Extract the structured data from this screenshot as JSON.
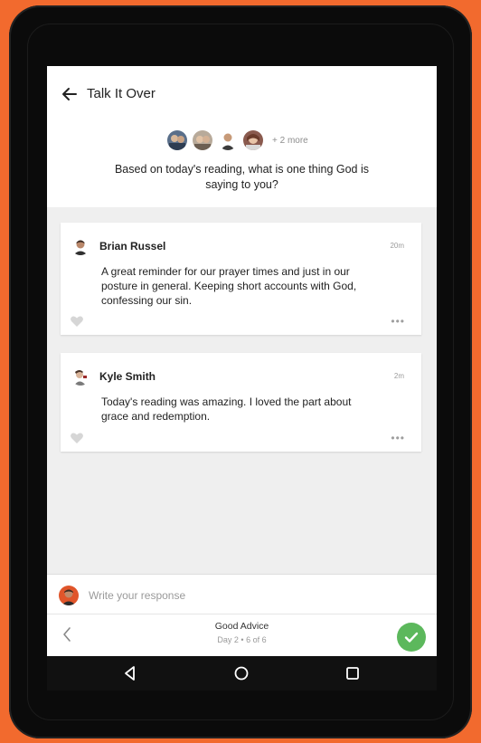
{
  "header": {
    "title": "Talk It Over",
    "more_participants": "+ 2 more",
    "question": "Based on today's reading, what is one thing God is saying to you?"
  },
  "posts": [
    {
      "author": "Brian Russel",
      "time": "20m",
      "body": "A great reminder for our prayer times and just in our posture in general. Keeping short accounts with God, confessing our sin."
    },
    {
      "author": "Kyle Smith",
      "time": "2m",
      "body": "Today's reading was amazing. I loved the part about grace and redemption."
    }
  ],
  "response": {
    "placeholder": "Write your response"
  },
  "lesson": {
    "title": "Good Advice",
    "subtitle": "Day 2 • 6 of 6"
  },
  "icons": {
    "back": "arrow-left-icon",
    "like": "heart-icon",
    "more": "more-dots-icon",
    "prev": "chevron-left-icon",
    "complete": "check-circle-icon",
    "sys_back": "triangle-back-icon",
    "sys_home": "circle-home-icon",
    "sys_recents": "square-recents-icon"
  },
  "colors": {
    "frame_background": "#f26a2e",
    "device": "#0b0b0b",
    "complete_button": "#5cb85c",
    "feed_background": "#efefef"
  }
}
